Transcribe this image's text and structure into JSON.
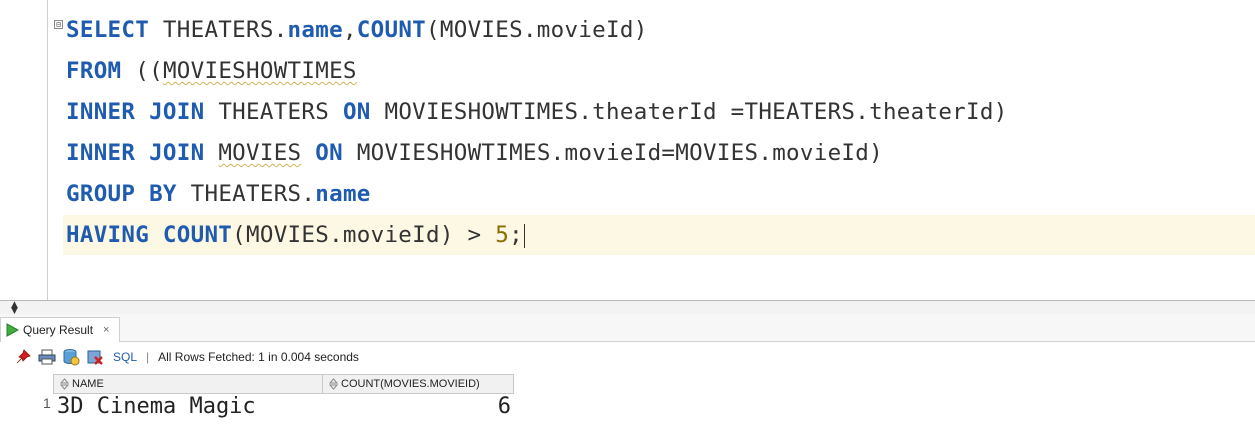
{
  "editor": {
    "fold_symbol": "⊟",
    "lines": [
      {
        "parts": [
          {
            "text": "SELECT",
            "cls": "kw"
          },
          {
            "text": " THEATERS.",
            "cls": ""
          },
          {
            "text": "name",
            "cls": "fn"
          },
          {
            "text": ",",
            "cls": ""
          },
          {
            "text": "COUNT",
            "cls": "fn"
          },
          {
            "text": "(MOVIES.movieId)",
            "cls": ""
          }
        ]
      },
      {
        "parts": [
          {
            "text": "FROM",
            "cls": "kw"
          },
          {
            "text": " ((",
            "cls": ""
          },
          {
            "text": "MOVIESHOWTIMES",
            "cls": "squig"
          }
        ]
      },
      {
        "parts": [
          {
            "text": "INNER JOIN",
            "cls": "kw"
          },
          {
            "text": " THEATERS ",
            "cls": ""
          },
          {
            "text": "ON",
            "cls": "kw"
          },
          {
            "text": " MOVIESHOWTIMES.theaterId =THEATERS.theaterId)",
            "cls": ""
          }
        ]
      },
      {
        "parts": [
          {
            "text": "INNER JOIN",
            "cls": "kw"
          },
          {
            "text": " ",
            "cls": ""
          },
          {
            "text": "MOVIES",
            "cls": "squig"
          },
          {
            "text": " ",
            "cls": ""
          },
          {
            "text": "ON",
            "cls": "kw"
          },
          {
            "text": " MOVIESHOWTIMES.movieId=MOVIES.movieId)",
            "cls": ""
          }
        ]
      },
      {
        "parts": [
          {
            "text": "GROUP BY",
            "cls": "kw"
          },
          {
            "text": " THEATERS.",
            "cls": ""
          },
          {
            "text": "name",
            "cls": "fn"
          }
        ]
      },
      {
        "parts": [
          {
            "text": "HAVING COUNT",
            "cls": "kw"
          },
          {
            "text": "(MOVIES.movieId) > ",
            "cls": ""
          },
          {
            "text": "5",
            "cls": "num"
          },
          {
            "text": ";",
            "cls": ""
          }
        ]
      }
    ]
  },
  "result_panel": {
    "tab_label": "Query Result",
    "tab_close": "×",
    "toolbar": {
      "sql_label": "SQL",
      "separator": "|",
      "status": "All Rows Fetched: 1 in 0.004 seconds"
    },
    "columns": [
      "NAME",
      "COUNT(MOVIES.MOVIEID)"
    ],
    "rows": [
      {
        "num": "1",
        "name": "3D Cinema Magic",
        "count": "6"
      }
    ]
  }
}
